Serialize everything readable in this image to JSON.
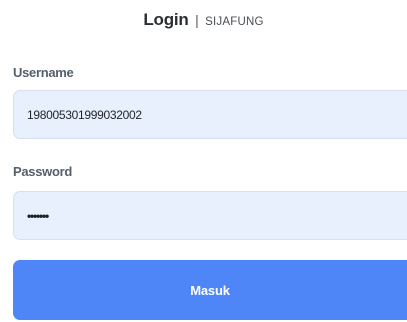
{
  "header": {
    "title": "Login",
    "separator": "|",
    "app_name": "SIJAFUNG"
  },
  "form": {
    "username": {
      "label": "Username",
      "value": "198005301999032002"
    },
    "password": {
      "label": "Password",
      "masked_value": "•••••••"
    },
    "submit_label": "Masuk"
  },
  "colors": {
    "accent": "#4f86f7",
    "input_background": "#e8effd",
    "label_text": "#56606b",
    "heading_text": "#2b2f33"
  }
}
